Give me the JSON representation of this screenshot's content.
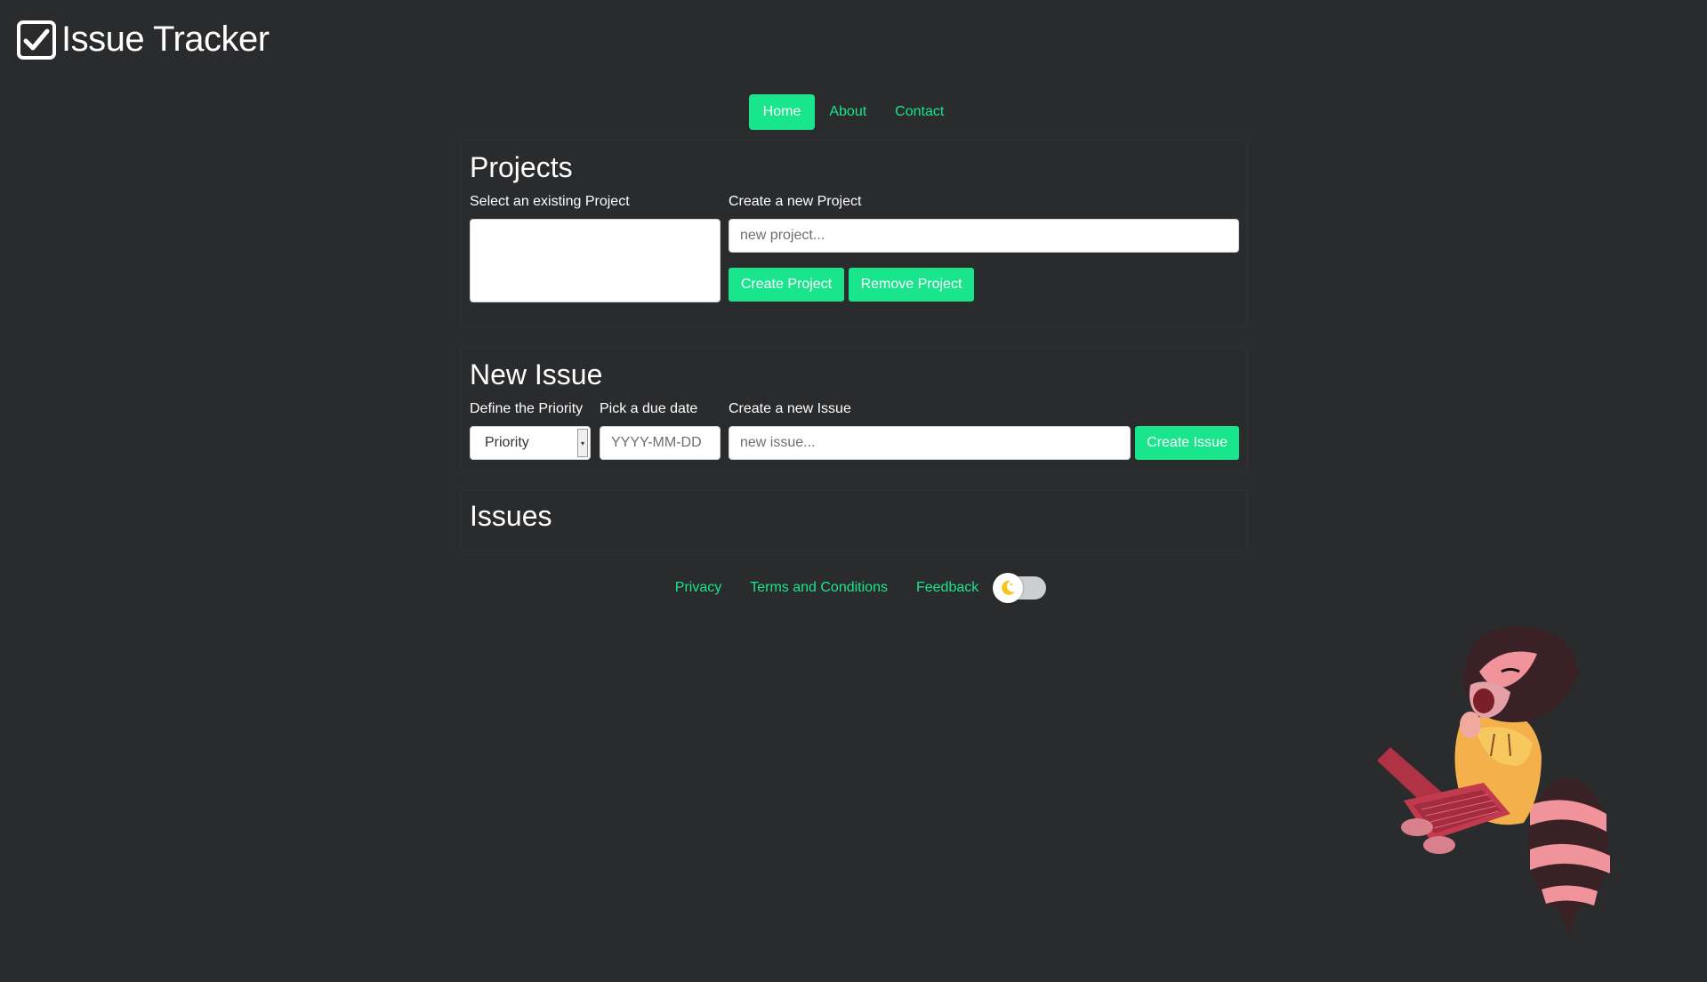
{
  "app": {
    "title": "Issue Tracker"
  },
  "nav": {
    "items": [
      {
        "label": "Home",
        "active": true
      },
      {
        "label": "About",
        "active": false
      },
      {
        "label": "Contact",
        "active": false
      }
    ]
  },
  "projects": {
    "heading": "Projects",
    "select_label": "Select an existing Project",
    "create_label": "Create a new Project",
    "input_placeholder": "new project...",
    "create_button": "Create Project",
    "remove_button": "Remove Project"
  },
  "new_issue": {
    "heading": "New Issue",
    "priority_label": "Define the Priority",
    "priority_value": "Priority",
    "due_label": "Pick a due date",
    "due_placeholder": "YYYY-MM-DD",
    "issue_label": "Create a new Issue",
    "issue_placeholder": "new issue...",
    "create_button": "Create Issue"
  },
  "issues": {
    "heading": "Issues"
  },
  "footer": {
    "links": [
      "Privacy",
      "Terms and Conditions",
      "Feedback"
    ]
  },
  "theme": {
    "accent": "#19e68c",
    "background": "#2a2b2d",
    "toggle_icon": "moon-icon"
  }
}
